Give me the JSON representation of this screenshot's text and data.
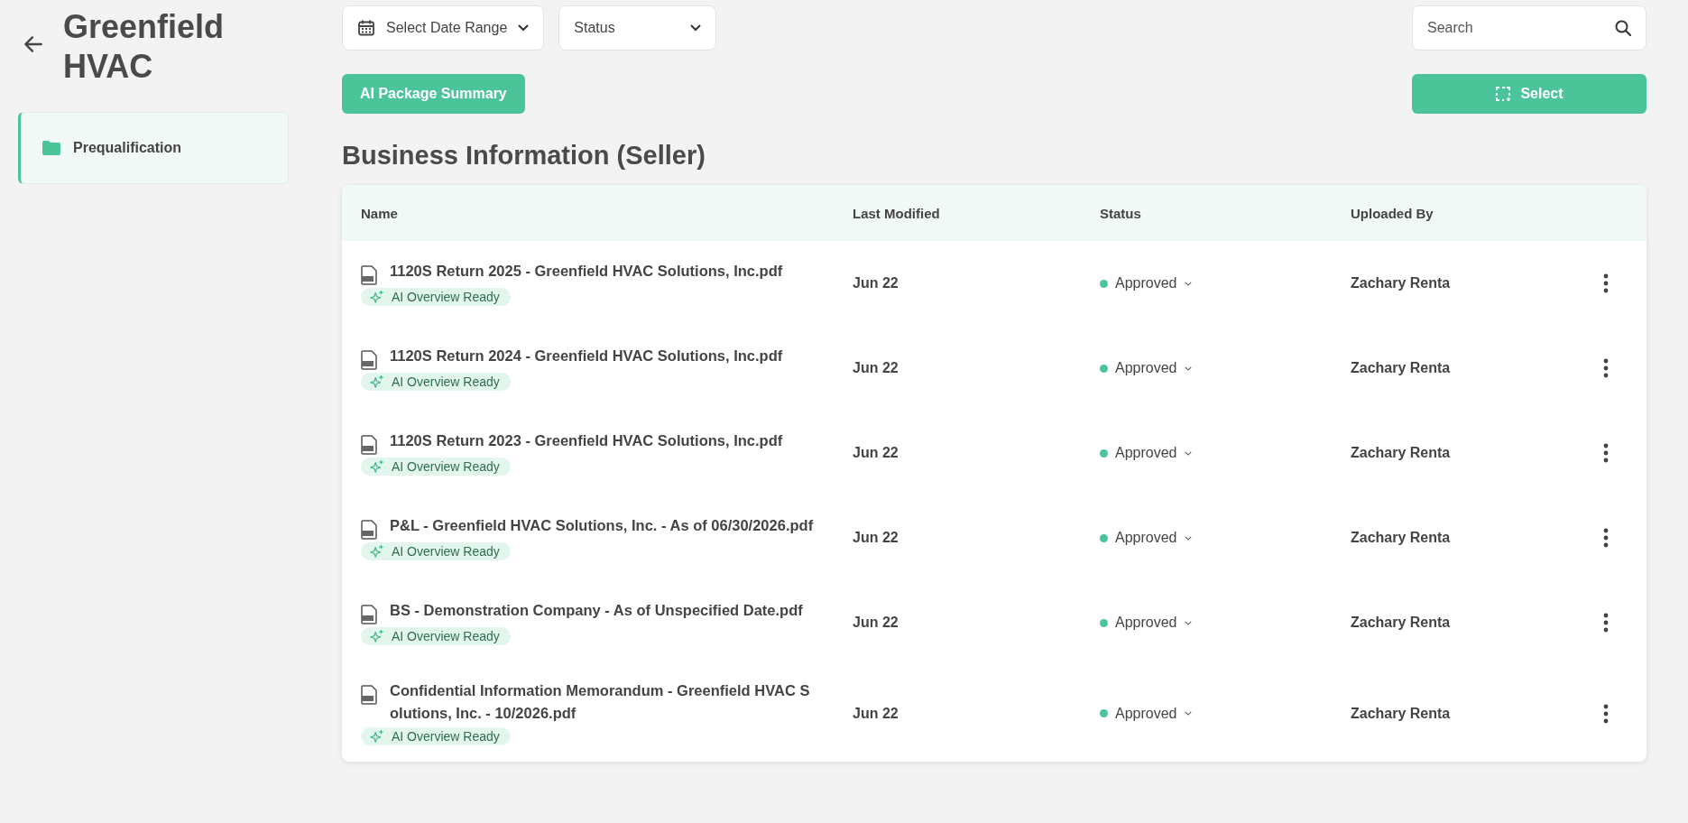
{
  "header": {
    "title": "Greenfield HVAC"
  },
  "sidebar": {
    "items": [
      {
        "label": "Prequalification",
        "selected": true
      }
    ]
  },
  "filters": {
    "date_range": "Select Date Range",
    "status": "Status",
    "search": {
      "placeholder": "Search"
    }
  },
  "actions": {
    "summary_button": "AI Package Summary",
    "select_button": "Select"
  },
  "section": {
    "title": "Business Information (Seller)"
  },
  "table": {
    "columns": [
      "Name",
      "Last Modified",
      "Status",
      "Uploaded By"
    ],
    "rows": [
      {
        "name": "1120S Return 2025 - Greenfield HVAC Solutions, Inc.pdf",
        "badge": "AI Overview Ready",
        "modified": "Jun 22",
        "status": "Approved",
        "uploaded_by": "Zachary Renta"
      },
      {
        "name": "1120S Return 2024 - Greenfield HVAC Solutions, Inc.pdf",
        "badge": "AI Overview Ready",
        "modified": "Jun 22",
        "status": "Approved",
        "uploaded_by": "Zachary Renta"
      },
      {
        "name": "1120S Return 2023 - Greenfield HVAC Solutions, Inc.pdf",
        "badge": "AI Overview Ready",
        "modified": "Jun 22",
        "status": "Approved",
        "uploaded_by": "Zachary Renta"
      },
      {
        "name": "P&L - Greenfield HVAC Solutions, Inc. - As of 06/30/2026.pdf",
        "badge": "AI Overview Ready",
        "modified": "Jun 22",
        "status": "Approved",
        "uploaded_by": "Zachary Renta"
      },
      {
        "name": "BS - Demonstration Company - As of Unspecified Date.pdf",
        "badge": "AI Overview Ready",
        "modified": "Jun 22",
        "status": "Approved",
        "uploaded_by": "Zachary Renta"
      },
      {
        "name": "Confidential Information Memorandum - Greenfield HVAC Solutions, Inc. - 10/2026.pdf",
        "badge": "AI Overview Ready",
        "modified": "Jun 22",
        "status": "Approved",
        "uploaded_by": "Zachary Renta"
      }
    ]
  }
}
